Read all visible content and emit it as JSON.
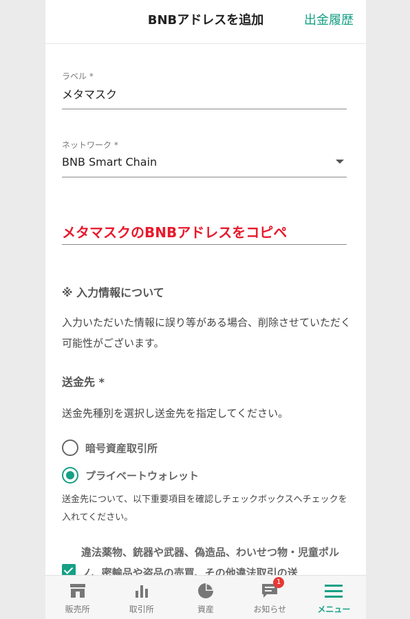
{
  "header": {
    "title": "BNBアドレスを追加",
    "history_link": "出金履歴"
  },
  "form": {
    "label_field": {
      "label": "ラベル *",
      "value": "メタマスク"
    },
    "network_field": {
      "label": "ネットワーク *",
      "value": "BNB Smart Chain"
    },
    "address_overlay": "メタマスクのBNBアドレスをコピペ"
  },
  "notice": {
    "title": "※ 入力情報について",
    "body": "入力いただいた情報に誤り等がある場合、削除させていただく可能性がございます。"
  },
  "destination": {
    "title": "送金先 *",
    "desc": "送金先種別を選択し送金先を指定してください。",
    "options": [
      {
        "label": "暗号資産取引所",
        "selected": false
      },
      {
        "label": "プライベートウォレット",
        "selected": true
      }
    ],
    "confirm_text": "送金先について、以下重要項目を確認しチェックボックスへチェックを入れてください。",
    "warning_text": "違法薬物、銃器や武器、偽造品、わいせつ物・児童ポルノ、密輸品や盗品の売買、その他違法取引の送",
    "warning_checked": true
  },
  "tabbar": {
    "tabs": [
      {
        "label": "販売所",
        "icon": "shop-icon",
        "active": false
      },
      {
        "label": "取引所",
        "icon": "bar-chart-icon",
        "active": false
      },
      {
        "label": "資産",
        "icon": "pie-chart-icon",
        "active": false
      },
      {
        "label": "お知らせ",
        "icon": "message-icon",
        "active": false,
        "badge": "1"
      },
      {
        "label": "メニュー",
        "icon": "menu-icon",
        "active": true
      }
    ]
  },
  "colors": {
    "accent": "#16a085",
    "overlay_red": "#e8192c",
    "badge_red": "#e53935"
  }
}
